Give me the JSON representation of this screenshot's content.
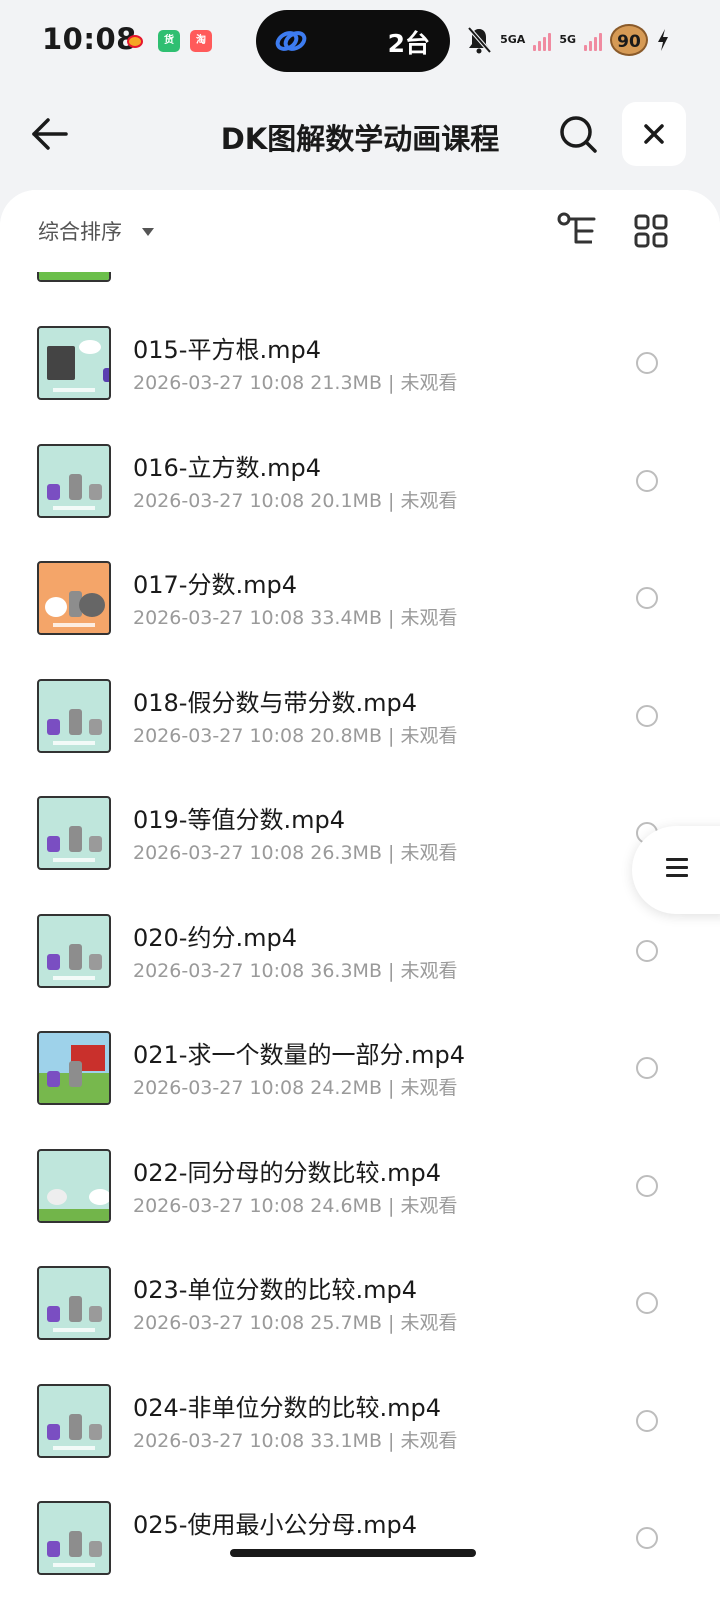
{
  "status_bar": {
    "time": "10:08",
    "apps": [
      "weibo-icon",
      "huo-app-icon",
      "taobao-icon"
    ],
    "huo_app_label": "货",
    "taobao_label": "淘",
    "pill_count": "2台",
    "network_1": "5GA",
    "network_2": "5G",
    "battery": "90"
  },
  "header": {
    "title": "DK图解数学动画课程"
  },
  "sort": {
    "label": "综合排序"
  },
  "files": [
    {
      "name": "015-平方根.mp4",
      "meta": "2026-03-27 10:08  21.3MB | 未观看",
      "thumb": "portrait"
    },
    {
      "name": "016-立方数.mp4",
      "meta": "2026-03-27 10:08  20.1MB | 未观看",
      "thumb": "mint"
    },
    {
      "name": "017-分数.mp4",
      "meta": "2026-03-27 10:08  33.4MB | 未观看",
      "thumb": "orange"
    },
    {
      "name": "018-假分数与带分数.mp4",
      "meta": "2026-03-27 10:08  20.8MB | 未观看",
      "thumb": "mint"
    },
    {
      "name": "019-等值分数.mp4",
      "meta": "2026-03-27 10:08  26.3MB | 未观看",
      "thumb": "mint"
    },
    {
      "name": "020-约分.mp4",
      "meta": "2026-03-27 10:08  36.3MB | 未观看",
      "thumb": "mint"
    },
    {
      "name": "021-求一个数量的一部分.mp4",
      "meta": "2026-03-27 10:08  24.2MB | 未观看",
      "thumb": "farm"
    },
    {
      "name": "022-同分母的分数比较.mp4",
      "meta": "2026-03-27 10:08  24.6MB | 未观看",
      "thumb": "grass"
    },
    {
      "name": "023-单位分数的比较.mp4",
      "meta": "2026-03-27 10:08  25.7MB | 未观看",
      "thumb": "mint"
    },
    {
      "name": "024-非单位分数的比较.mp4",
      "meta": "2026-03-27 10:08  33.1MB | 未观看",
      "thumb": "mint"
    },
    {
      "name": "025-使用最小公分母.mp4",
      "meta": "",
      "thumb": "mint"
    }
  ]
}
